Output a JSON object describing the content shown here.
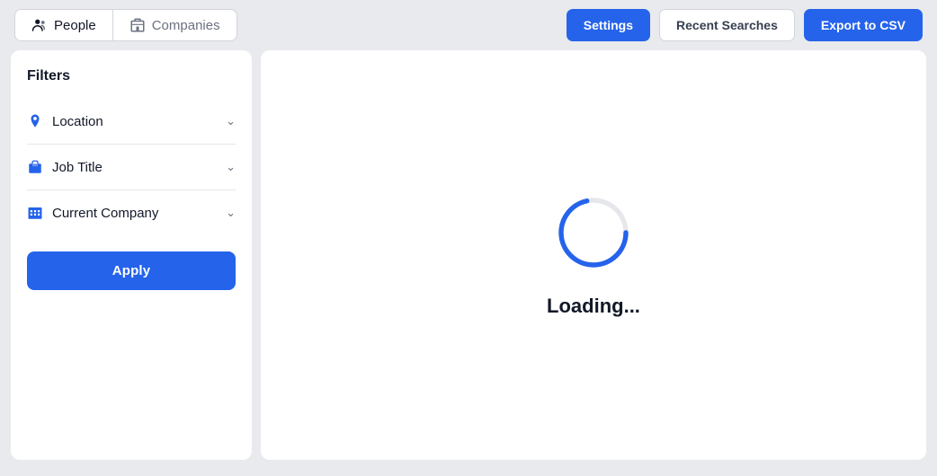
{
  "tabs": [
    {
      "id": "people",
      "label": "People",
      "active": true
    },
    {
      "id": "companies",
      "label": "Companies",
      "active": false
    }
  ],
  "nav_buttons": {
    "settings": "Settings",
    "recent_searches": "Recent Searches",
    "export_csv": "Export to CSV"
  },
  "sidebar": {
    "title": "Filters",
    "filters": [
      {
        "id": "location",
        "label": "Location",
        "icon": "location-icon"
      },
      {
        "id": "job-title",
        "label": "Job Title",
        "icon": "job-title-icon"
      },
      {
        "id": "current-company",
        "label": "Current Company",
        "icon": "company-icon"
      }
    ],
    "apply_button": "Apply"
  },
  "content": {
    "loading_text": "Loading..."
  }
}
